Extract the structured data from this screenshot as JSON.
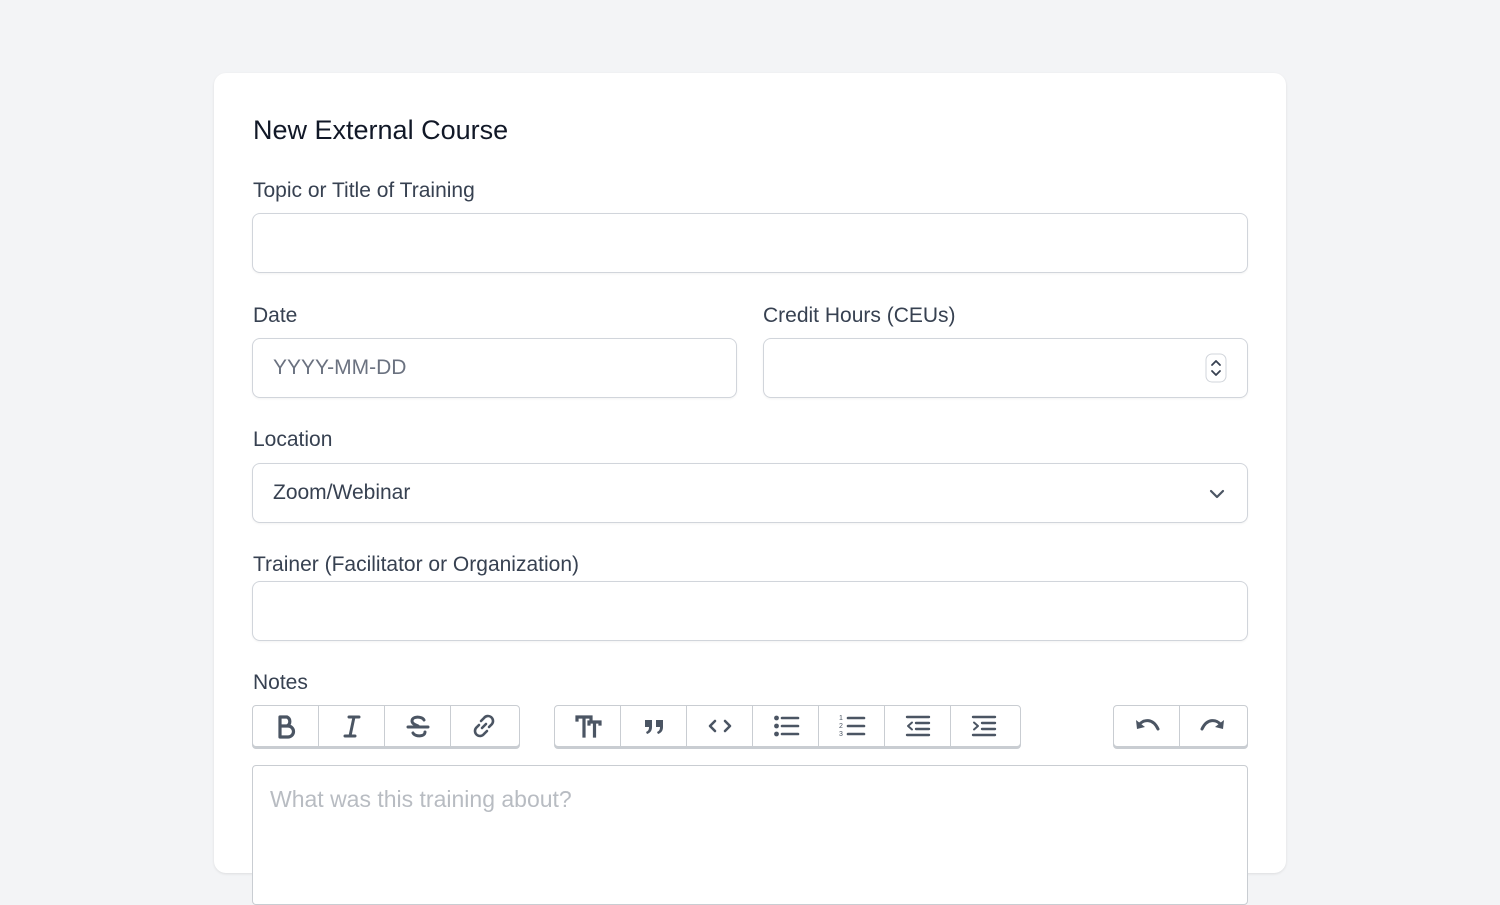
{
  "form": {
    "title": "New External Course",
    "topic": {
      "label": "Topic or Title of Training",
      "value": ""
    },
    "date": {
      "label": "Date",
      "placeholder": "YYYY-MM-DD",
      "value": ""
    },
    "credit_hours": {
      "label": "Credit Hours (CEUs)",
      "value": ""
    },
    "location": {
      "label": "Location",
      "selected": "Zoom/Webinar"
    },
    "trainer": {
      "label": "Trainer (Facilitator or Organization)",
      "value": ""
    },
    "notes": {
      "label": "Notes",
      "placeholder": "What was this training about?"
    }
  },
  "toolbar": {
    "text_tools": [
      "bold-icon",
      "italic-icon",
      "strikethrough-icon",
      "link-icon"
    ],
    "block_tools": [
      "heading-icon",
      "quote-icon",
      "code-icon",
      "bullet-list-icon",
      "numbered-list-icon",
      "outdent-icon",
      "indent-icon"
    ],
    "history_tools": [
      "undo-icon",
      "redo-icon"
    ]
  },
  "colors": {
    "background": "#f3f4f6",
    "card": "#ffffff",
    "border": "#d1d5db",
    "text": "#374151",
    "title": "#111827"
  }
}
